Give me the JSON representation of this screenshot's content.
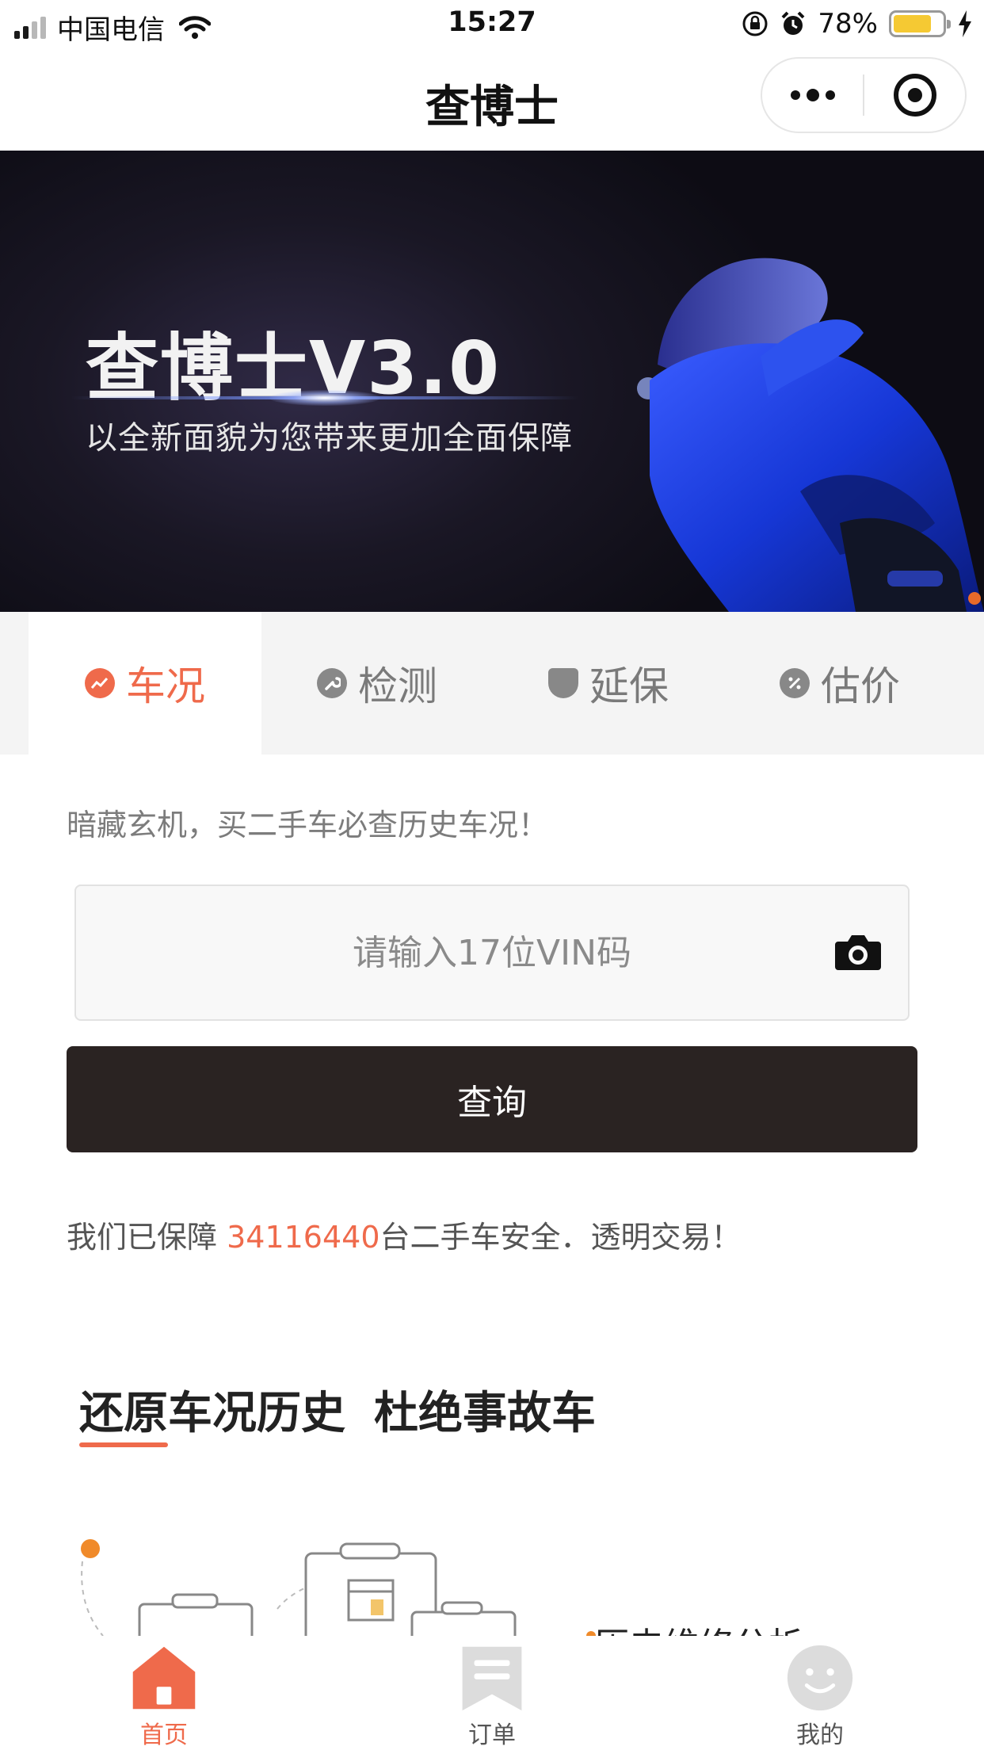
{
  "status_bar": {
    "carrier": "中国电信",
    "time": "15:27",
    "battery_percent": "78%",
    "battery_level": 0.78
  },
  "nav": {
    "title": "查博士"
  },
  "banner": {
    "title": "查博士V3.0",
    "subtitle": "以全新面貌为您带来更加全面保障"
  },
  "tabs": [
    {
      "label": "车况",
      "icon": "chart-icon",
      "active": true
    },
    {
      "label": "检测",
      "icon": "wrench-icon",
      "active": false
    },
    {
      "label": "延保",
      "icon": "shield-icon",
      "active": false
    },
    {
      "label": "估价",
      "icon": "percent-icon",
      "active": false
    }
  ],
  "main": {
    "tagline": "暗藏玄机，买二手车必查历史车况！",
    "vin_placeholder": "请输入17位VIN码",
    "vin_value": "",
    "query_label": "查询",
    "guarantee_prefix": "我们已保障 ",
    "guarantee_count": "34116440",
    "guarantee_suffix": "台二手车安全．透明交易！",
    "section_title_1": "还原车况历史",
    "section_title_2": "杜绝事故车",
    "illus_label": "历史维修分析"
  },
  "tabbar": [
    {
      "label": "首页",
      "icon": "home-icon",
      "active": true
    },
    {
      "label": "订单",
      "icon": "bookmark-icon",
      "active": false
    },
    {
      "label": "我的",
      "icon": "smiley-icon",
      "active": false
    }
  ],
  "colors": {
    "accent": "#ef6a4b",
    "button_dark": "#2a2322",
    "battery": "#f5c933"
  }
}
